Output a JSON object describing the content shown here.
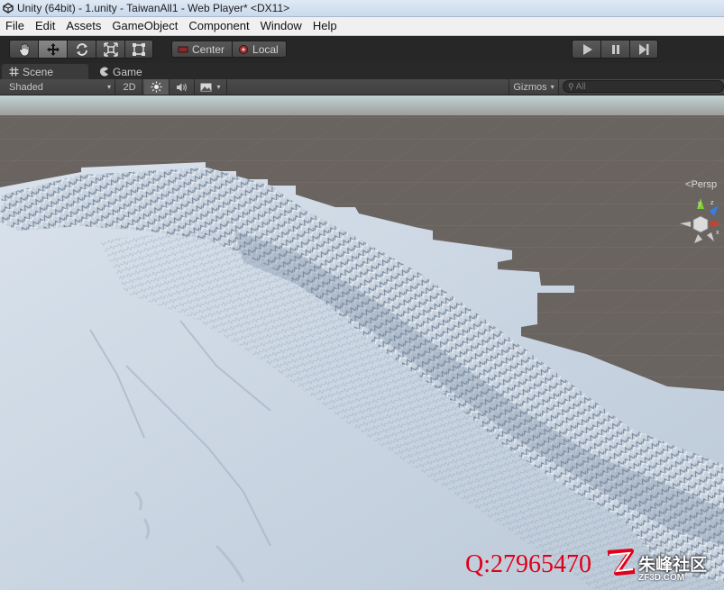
{
  "window": {
    "title": "Unity (64bit) - 1.unity - TaiwanAll1 - Web Player* <DX11>"
  },
  "menu": [
    "File",
    "Edit",
    "Assets",
    "GameObject",
    "Component",
    "Window",
    "Help"
  ],
  "toolbar": {
    "tools": [
      "hand-icon",
      "move-icon",
      "rotate-icon",
      "scale-icon",
      "rect-icon"
    ],
    "active_tool": "move-icon",
    "pivot_center": "Center",
    "pivot_local": "Local",
    "playback": [
      "play-icon",
      "pause-icon",
      "step-icon"
    ]
  },
  "tabs": {
    "scene": "Scene",
    "game": "Game"
  },
  "scene_toolbar": {
    "draw_mode": "Shaded",
    "mode_2d": "2D",
    "gizmos": "Gizmos",
    "search_placeholder": "All"
  },
  "viewport": {
    "projection_label": "Persp",
    "axes": [
      "y",
      "z",
      "x"
    ],
    "colors": {
      "ground": "#6a6461",
      "terrain": "#cdd8e4",
      "sky": "#b6c6cc"
    }
  },
  "watermark": {
    "qq": "Q:27965470",
    "logo_name": "朱峰社区",
    "logo_url": "ZF3D.COM"
  }
}
